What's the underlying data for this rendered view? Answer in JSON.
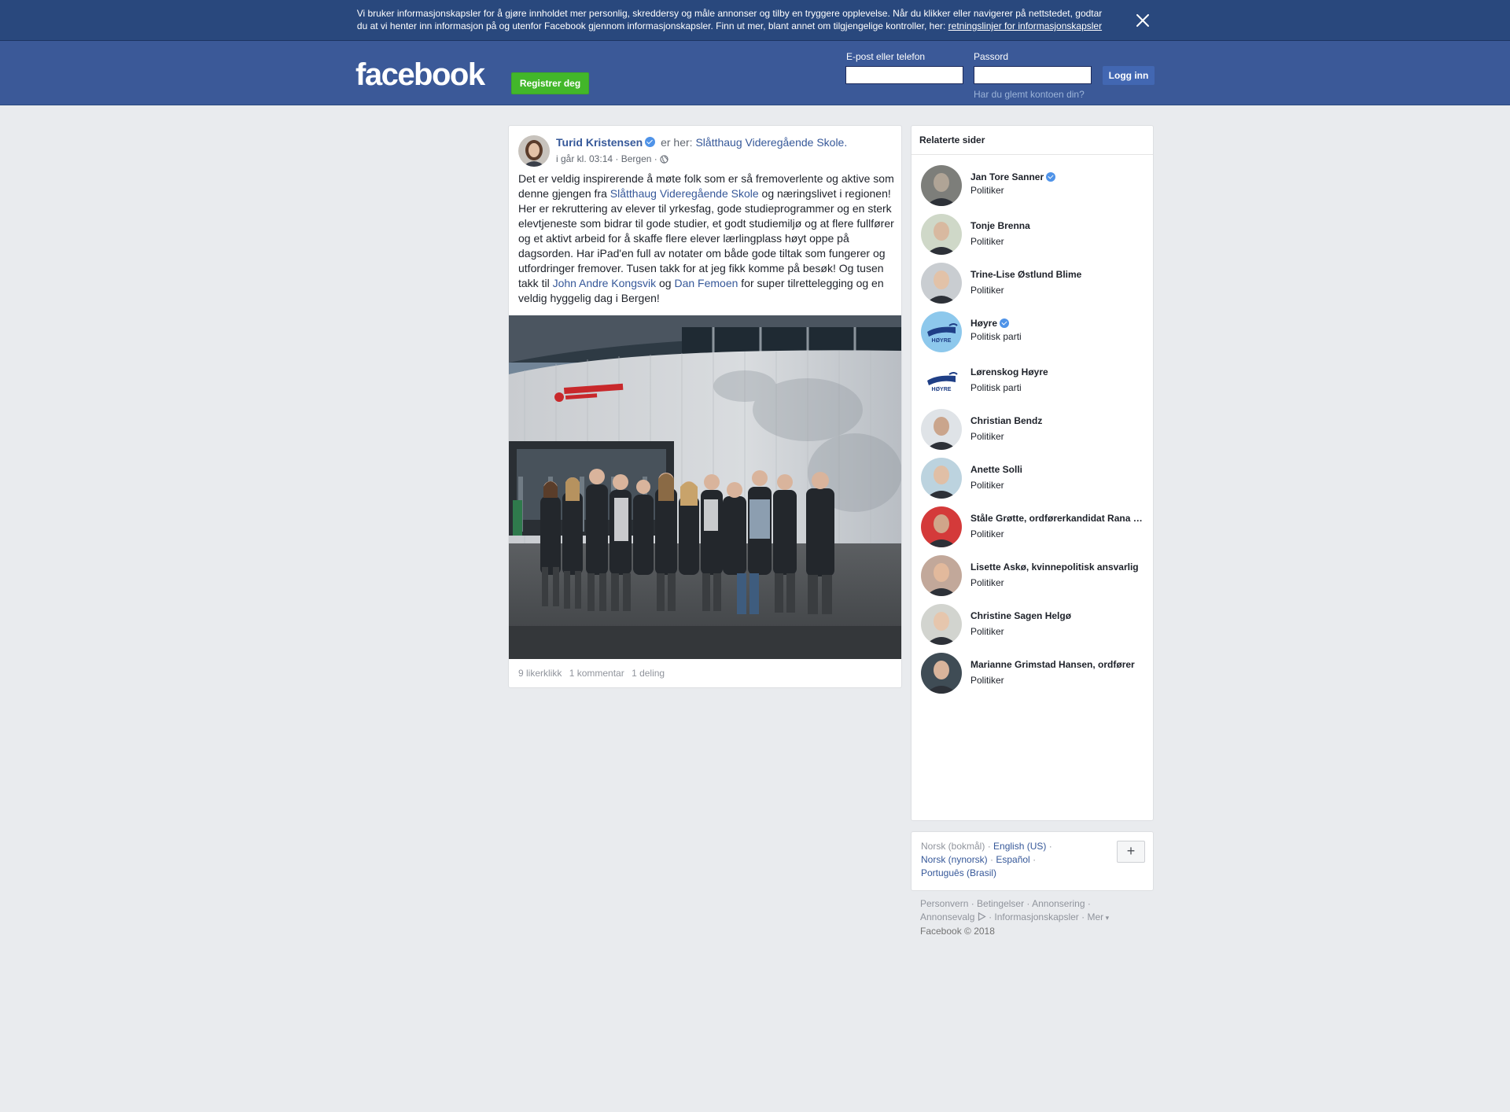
{
  "cookie_banner": {
    "text": "Vi bruker informasjonskapsler for å gjøre innholdet mer personlig, skreddersy og måle annonser og tilby en tryggere opplevelse. Når du klikker eller navigerer på nettstedet, godtar du at vi henter inn informasjon på og utenfor Facebook gjennom informasjonskapsler. Finn ut mer, blant annet om tilgjengelige kontroller, her: ",
    "policy_link": "retningslinjer for informasjonskapsler",
    "close_icon": "close-icon"
  },
  "header": {
    "logo": "facebook",
    "register_label": "Registrer deg",
    "email_label": "E-post eller telefon",
    "password_label": "Passord",
    "login_label": "Logg inn",
    "forgot_link": "Har du glemt kontoen din?",
    "bg_color": "#3b5998"
  },
  "post": {
    "author": "Turid Kristensen",
    "at_text": "er her:",
    "place": "Slåtthaug Videregående Skole.",
    "time": "i går kl. 03:14",
    "location": "Bergen",
    "privacy_icon": "globe-icon",
    "body_parts": {
      "p1": "Det er veldig inspirerende å møte folk som er så fremoverlente og aktive som denne gjengen fra ",
      "link1": "Slåtthaug Videregående Skole",
      "p2": " og næringslivet i regionen! Her er rekruttering av elever til yrkesfag, gode studieprogrammer og en sterk elevtjeneste som bidrar til gode studier, et godt studiemiljø og at flere fullfører og et aktivt arbeid for å skaffe flere elever lærlingplass høyt oppe på dagsorden. Har iPad'en full av notater om både gode tiltak som fungerer og utfordringer fremover. Tusen takk for at jeg fikk komme på besøk! Og tusen takk til ",
      "link2": "John Andre Kongsvik",
      "p3": " og ",
      "link3": "Dan Femoen",
      "p4": " for super tilrettelegging og en veldig hyggelig dag i Bergen!"
    },
    "likes": "9 likerklikk",
    "comments": "1 kommentar",
    "shares": "1 deling"
  },
  "related": {
    "heading": "Relaterte sider",
    "items": [
      {
        "name": "Jan Tore Sanner",
        "category": "Politiker",
        "verified": true,
        "skin": "#b0a496",
        "bg": "#7d7e7a"
      },
      {
        "name": "Tonje Brenna",
        "category": "Politiker",
        "verified": false,
        "skin": "#d8b9a0",
        "bg": "#cfd8c8"
      },
      {
        "name": "Trine-Lise Østlund Blime",
        "category": "Politiker",
        "verified": false,
        "skin": "#e2c2a8",
        "bg": "#c9cdd1"
      },
      {
        "name": "Høyre",
        "category": "Politisk parti",
        "verified": true,
        "skin": "",
        "bg": "#8dc8ec"
      },
      {
        "name": "Lørenskog Høyre",
        "category": "Politisk parti",
        "verified": false,
        "skin": "",
        "bg": "#ffffff"
      },
      {
        "name": "Christian Bendz",
        "category": "Politiker",
        "verified": false,
        "skin": "#caa58c",
        "bg": "#dfe3e7"
      },
      {
        "name": "Anette Solli",
        "category": "Politiker",
        "verified": false,
        "skin": "#e0bfa6",
        "bg": "#bcd3df"
      },
      {
        "name": "Ståle Grøtte, ordførerkandidat Rana Høyre",
        "category": "Politiker",
        "verified": false,
        "skin": "#d0a58a",
        "bg": "#d43a3a"
      },
      {
        "name": "Lisette Askø, kvinnepolitisk ansvarlig",
        "category": "Politiker",
        "verified": false,
        "skin": "#e2b99c",
        "bg": "#c2a89a"
      },
      {
        "name": "Christine Sagen Helgø",
        "category": "Politiker",
        "verified": false,
        "skin": "#e6c6ad",
        "bg": "#d2d4cf"
      },
      {
        "name": "Marianne Grimstad Hansen, ordfører",
        "category": "Politiker",
        "verified": false,
        "skin": "#d9b49b",
        "bg": "#3f4c55"
      }
    ]
  },
  "languages": {
    "current": "Norsk (bokmål)",
    "others": [
      "English (US)",
      "Norsk (nynorsk)",
      "Español",
      "Português (Brasil)"
    ],
    "more_button": "+"
  },
  "footer": {
    "links": [
      "Personvern",
      "Betingelser",
      "Annonsering",
      "Annonsevalg",
      "Informasjonskapsler",
      "Mer"
    ],
    "copyright": "Facebook © 2018"
  }
}
